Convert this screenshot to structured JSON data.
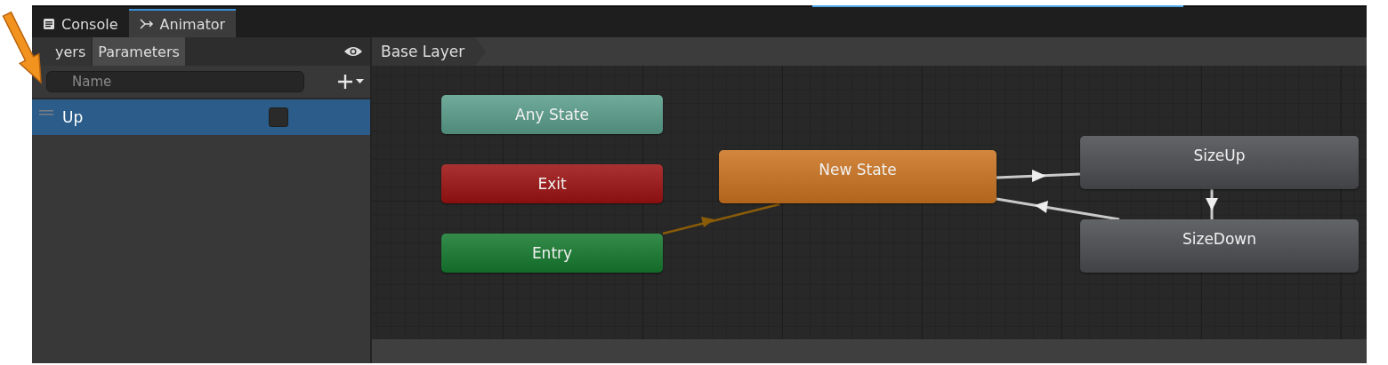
{
  "tabs": [
    {
      "label": "Console",
      "kind": "console",
      "selected": false
    },
    {
      "label": "Animator",
      "kind": "animator",
      "selected": true
    }
  ],
  "panel_tabs": [
    {
      "label": "yers",
      "selected": false
    },
    {
      "label": "Parameters",
      "selected": true
    }
  ],
  "search": {
    "placeholder": "Name"
  },
  "parameters": [
    {
      "name": "Up",
      "kind": "bool",
      "checked": false,
      "selected": true
    }
  ],
  "breadcrumb": "Base Layer",
  "states": [
    {
      "name": "Any State",
      "color": "#5a9e8b"
    },
    {
      "name": "Exit",
      "color": "#9e1212"
    },
    {
      "name": "Entry",
      "color": "#157a2f"
    },
    {
      "name": "New State",
      "color": "#cc7420"
    },
    {
      "name": "SizeUp",
      "color": "#4b4c50"
    },
    {
      "name": "SizeDown",
      "color": "#4b4c50"
    }
  ]
}
